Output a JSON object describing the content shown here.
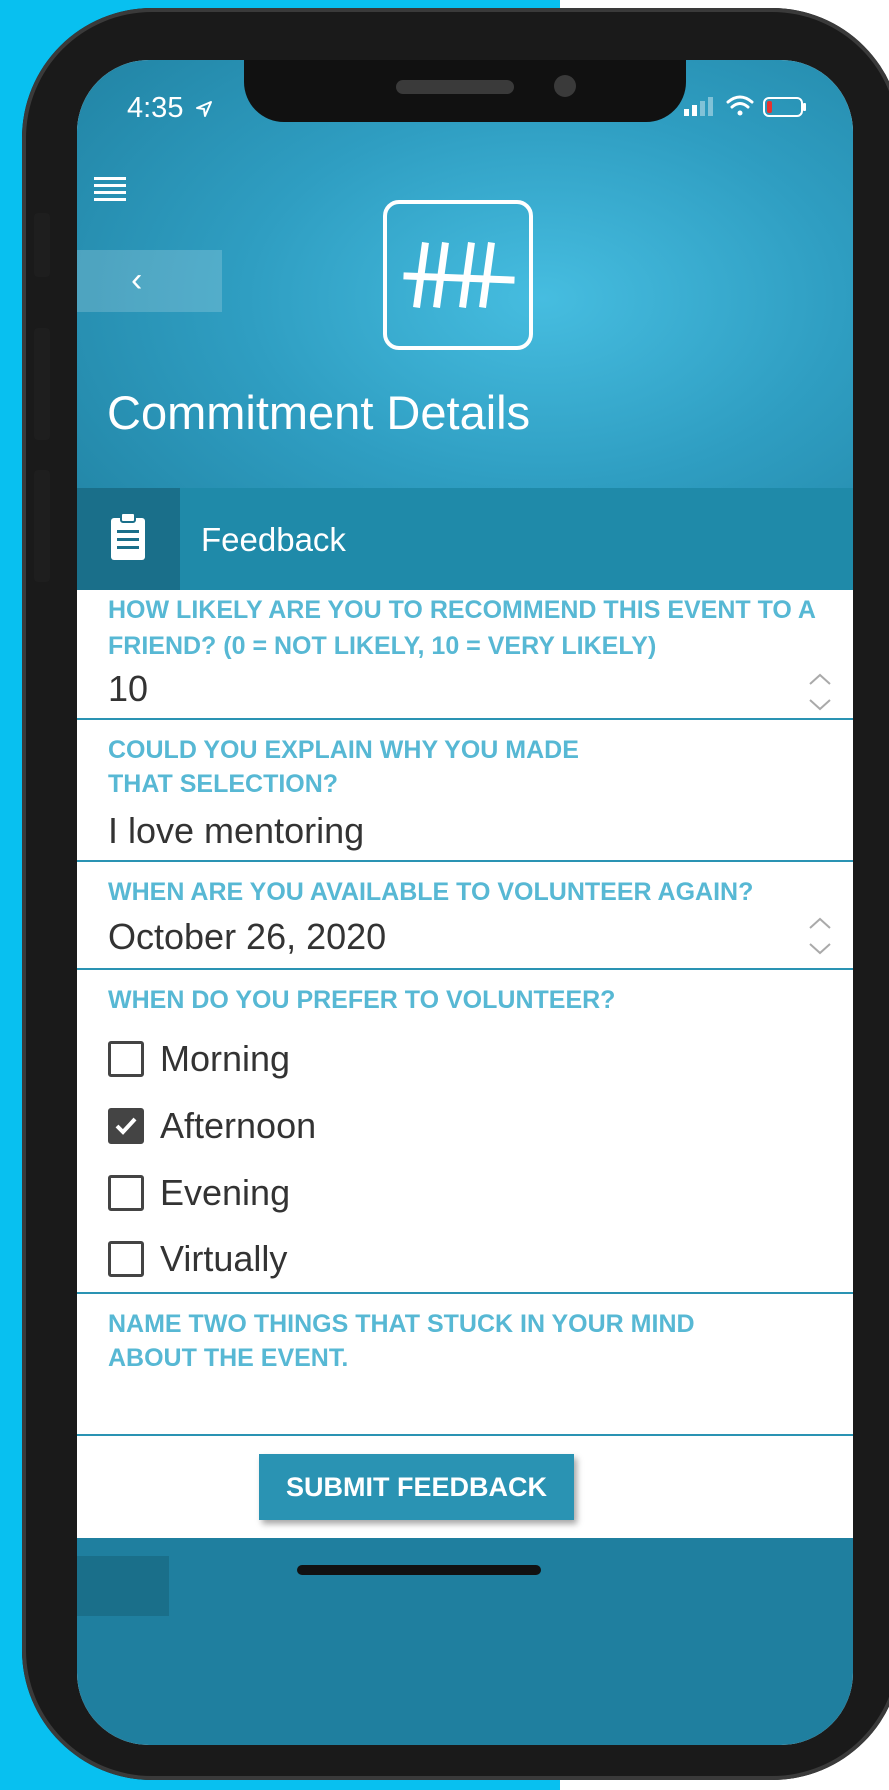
{
  "status_bar": {
    "time": "4:35",
    "location_icon": "location-arrow-icon",
    "signal_icon": "signal-bars-icon",
    "wifi_icon": "wifi-icon",
    "battery_icon": "battery-low-icon"
  },
  "header": {
    "menu_icon": "hamburger-menu-icon",
    "back_icon": "chevron-left-icon",
    "back_glyph": "‹",
    "logo_icon": "app-logo-icon",
    "title": "Commitment Details"
  },
  "section": {
    "icon": "clipboard-icon",
    "label": "Feedback"
  },
  "form": {
    "recommend": {
      "label": "HOW LIKELY ARE YOU TO RECOMMEND THIS EVENT TO A FRIEND? (0 = NOT LIKELY, 10 = VERY LIKELY)",
      "value": "10"
    },
    "explain": {
      "label_line1": "COULD YOU EXPLAIN WHY YOU MADE",
      "label_line2": "THAT SELECTION?",
      "value": "I love mentoring"
    },
    "availability": {
      "label": "WHEN ARE YOU AVAILABLE TO VOLUNTEER AGAIN?",
      "value": "October 26, 2020"
    },
    "preference": {
      "label": "WHEN DO YOU PREFER TO VOLUNTEER?",
      "options": [
        {
          "label": "Morning",
          "checked": false
        },
        {
          "label": "Afternoon",
          "checked": true
        },
        {
          "label": "Evening",
          "checked": false
        },
        {
          "label": "Virtually",
          "checked": false
        }
      ]
    },
    "memorable": {
      "label_line1": "NAME TWO THINGS THAT STUCK IN YOUR MIND",
      "label_line2": "ABOUT THE EVENT.",
      "value": ""
    }
  },
  "submit_label": "SUBMIT FEEDBACK",
  "colors": {
    "background_left": "#08c0f0",
    "header_accent": "#2f9ec2",
    "label_color": "#57b8d4",
    "button_color": "#2a93b3"
  }
}
